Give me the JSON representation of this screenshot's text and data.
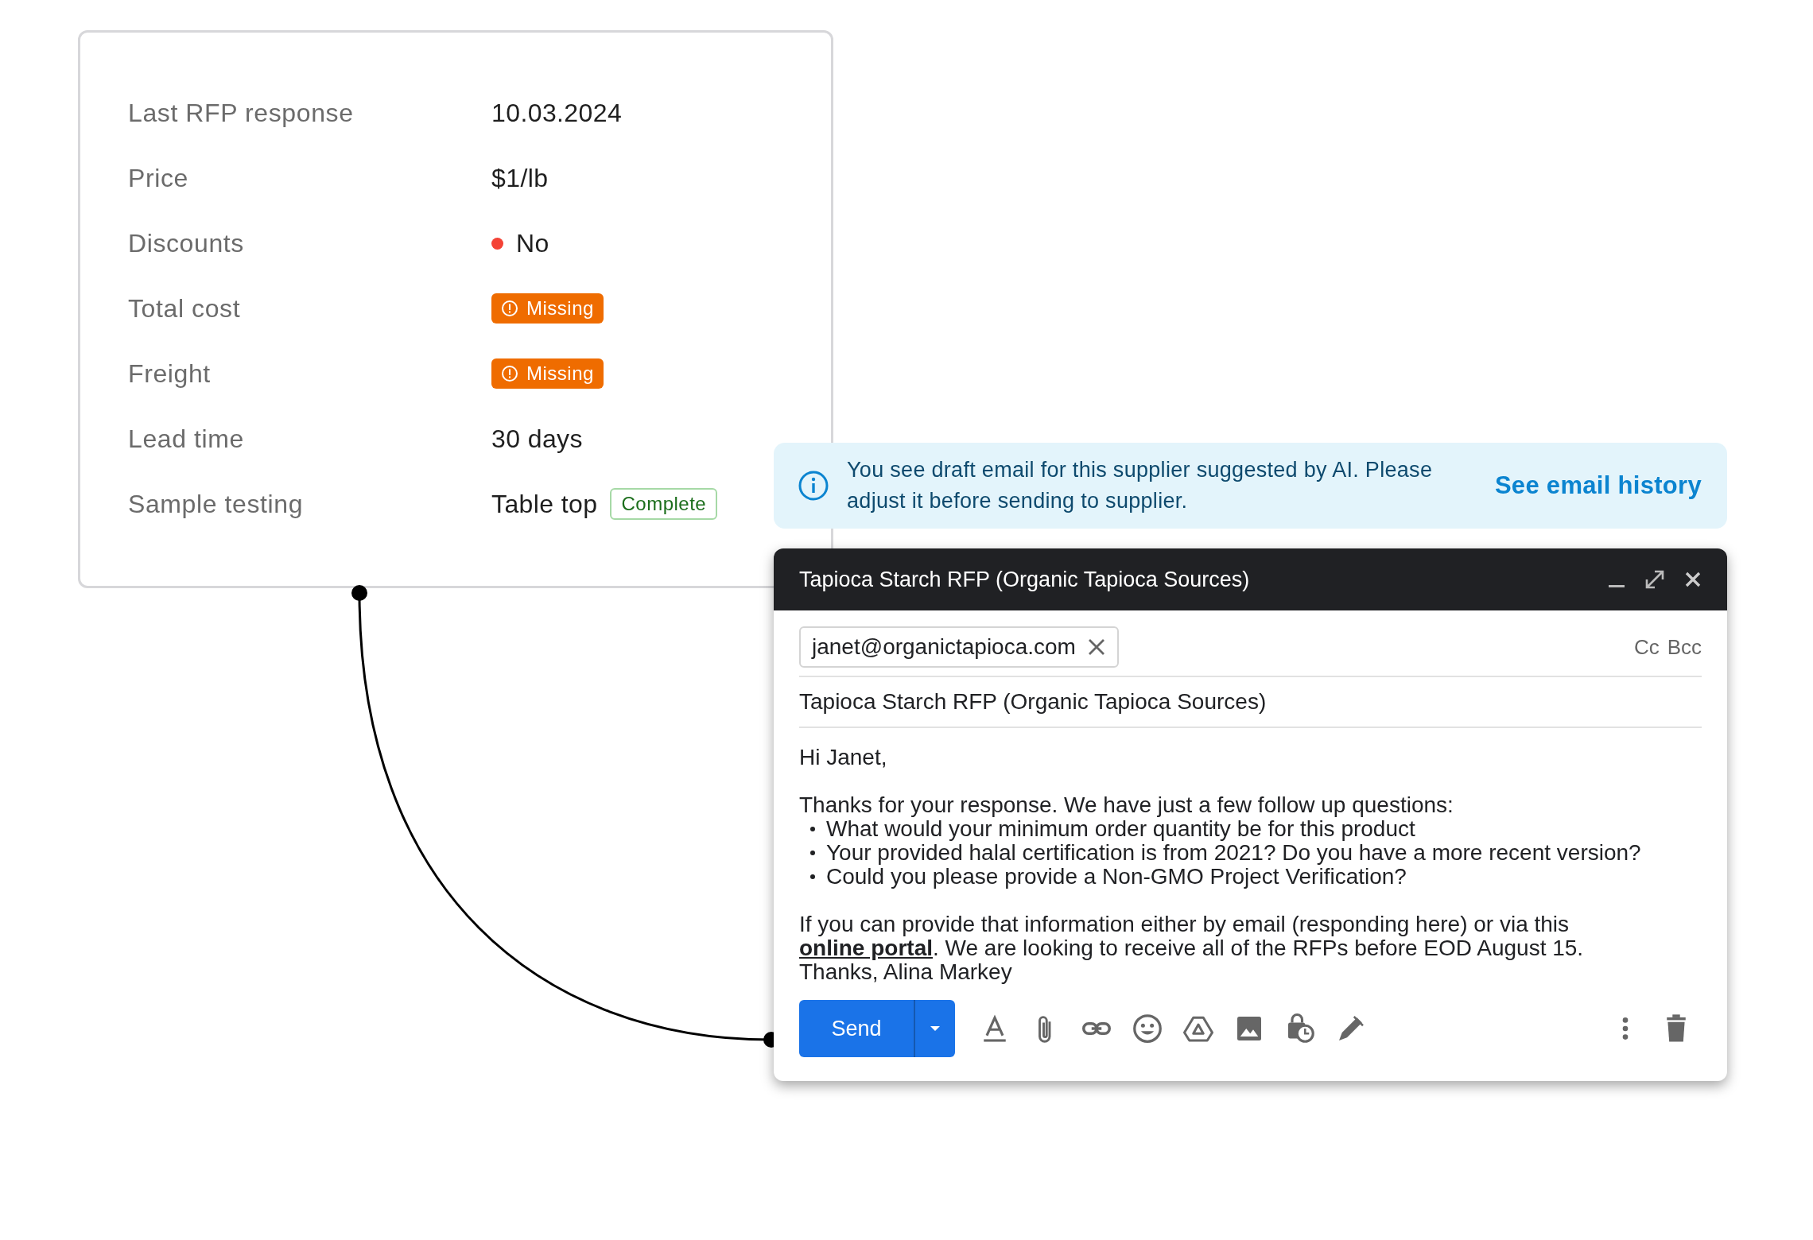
{
  "details": {
    "rows": [
      {
        "label": "Last RFP response",
        "kind": "text",
        "value": "10.03.2024"
      },
      {
        "label": "Price",
        "kind": "text",
        "value": "$1/lb"
      },
      {
        "label": "Discounts",
        "kind": "status",
        "value": "No",
        "color": "#f44336"
      },
      {
        "label": "Total cost",
        "kind": "badge",
        "badge": "Missing"
      },
      {
        "label": "Freight",
        "kind": "badge",
        "badge": "Missing"
      },
      {
        "label": "Lead time",
        "kind": "text",
        "value": "30 days"
      },
      {
        "label": "Sample testing",
        "kind": "tagged",
        "value": "Table top",
        "tag": "Complete"
      }
    ]
  },
  "banner": {
    "message": "You see draft email for this supplier suggested by AI. Please adjust it before sending to supplier.",
    "link": "See email history"
  },
  "email": {
    "title": "Tapioca Starch RFP (Organic Tapioca Sources)",
    "recipient": "janet@organictapioca.com",
    "cc": "Cc",
    "bcc": "Bcc",
    "subject": "Tapioca Starch RFP (Organic Tapioca Sources)",
    "greeting": "Hi Janet,",
    "intro": "Thanks for your response. We have just a few follow up questions:",
    "bullets": [
      "What would your minimum order quantity be for this product",
      "Your provided halal certification is from 2021? Do you have a more recent version?",
      "Could you please provide a Non-GMO Project Verification?"
    ],
    "paragraph_before": "If you can provide that information either by email (responding here) or via this ",
    "link": "online portal",
    "paragraph_after": ". We are looking to receive all of the RFPs before EOD August 15.",
    "signature": "Thanks, Alina Markey",
    "send": "Send"
  }
}
